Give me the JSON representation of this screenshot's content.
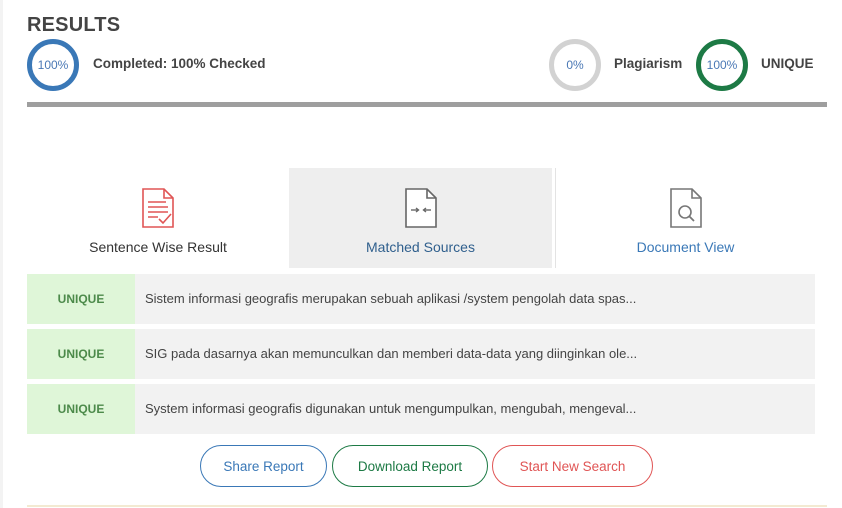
{
  "header": {
    "title": "RESULTS",
    "completed_percent": "100%",
    "completed_label": "Completed: 100% Checked",
    "plagiarism_percent": "0%",
    "plagiarism_label": "Plagiarism",
    "unique_percent": "100%",
    "unique_label": "UNIQUE"
  },
  "tabs": [
    {
      "label": "Sentence Wise Result",
      "icon": "document-check-icon",
      "active": false
    },
    {
      "label": "Matched Sources",
      "icon": "file-compare-icon",
      "active": true
    },
    {
      "label": "Document View",
      "icon": "file-search-icon",
      "active": false
    }
  ],
  "results": [
    {
      "status": "UNIQUE",
      "text": "Sistem informasi geografis merupakan sebuah aplikasi /system pengolah data spas..."
    },
    {
      "status": "UNIQUE",
      "text": "SIG pada dasarnya akan memunculkan dan memberi data-data yang diinginkan ole..."
    },
    {
      "status": "UNIQUE",
      "text": "System informasi geografis digunakan untuk mengumpulkan, mengubah, mengeval..."
    }
  ],
  "actions": {
    "share": "Share Report",
    "download": "Download Report",
    "new_search": "Start New Search"
  },
  "colors": {
    "completed_ring": "#3a78b7",
    "plagiarism_ring": "#d2d2d2",
    "unique_ring": "#1d7a45",
    "unique_badge_bg": "#dff6d8"
  }
}
